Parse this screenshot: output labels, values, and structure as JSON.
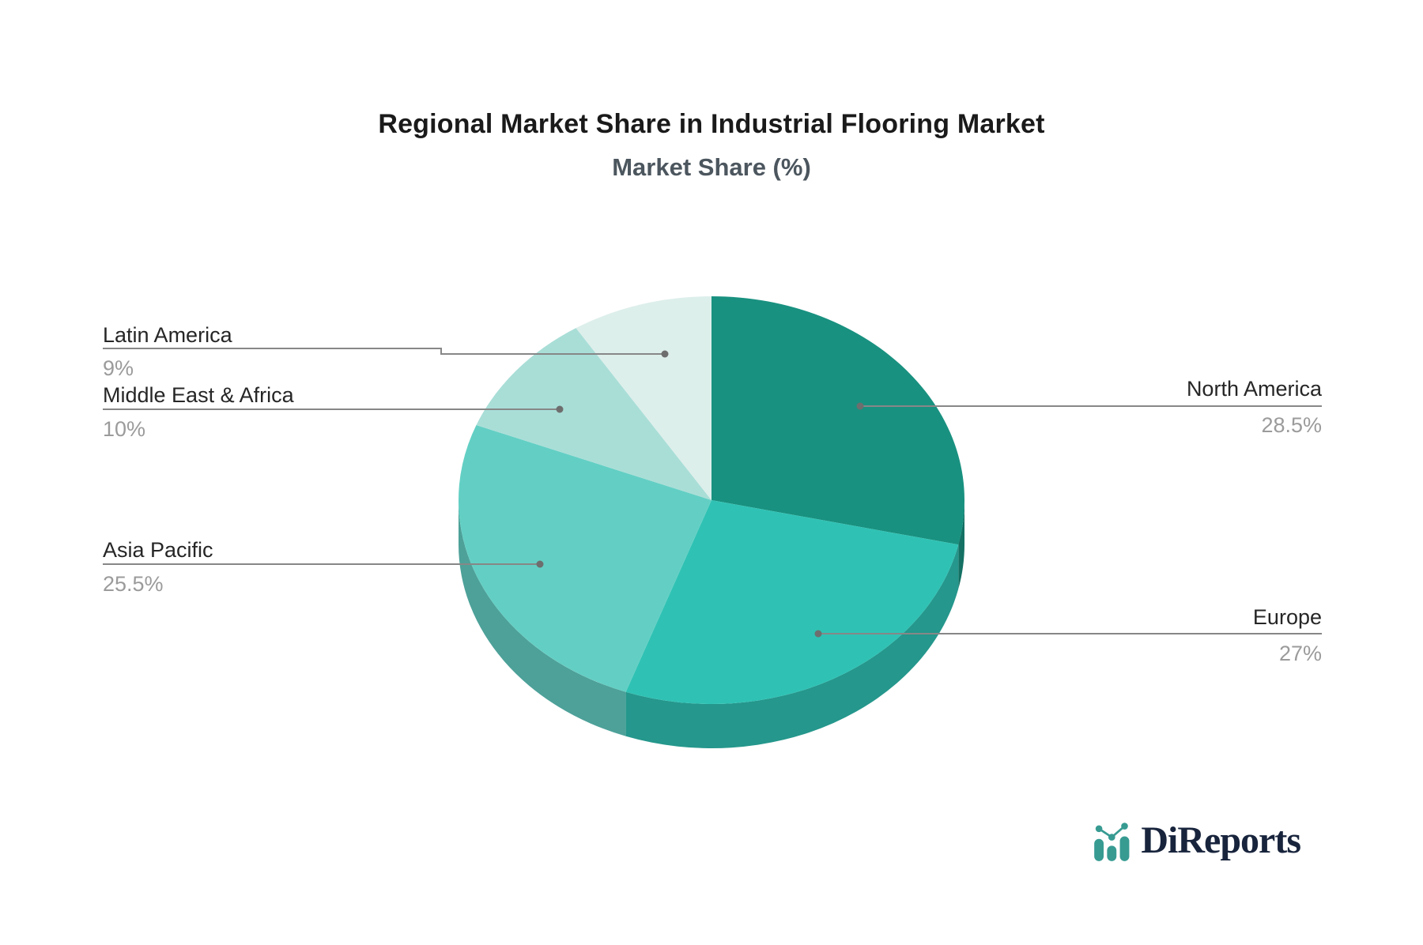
{
  "page": {
    "background": "#ffffff"
  },
  "chart_data": {
    "type": "pie",
    "title": "Regional Market Share in Industrial Flooring Market",
    "subtitle": "Market Share (%)",
    "effect": "3d",
    "direction": "clockwise",
    "start_angle_deg": 0,
    "legend_position": "none",
    "slices": [
      {
        "label": "North America",
        "value": 28.5,
        "display": "28.5%",
        "color": "#199180"
      },
      {
        "label": "Europe",
        "value": 27,
        "display": "27%",
        "color": "#2fc2b4"
      },
      {
        "label": "Asia Pacific",
        "value": 25.5,
        "display": "25.5%",
        "color": "#63cfc4"
      },
      {
        "label": "Middle East & Africa",
        "value": 10,
        "display": "10%",
        "color": "#a9ded7"
      },
      {
        "label": "Latin America",
        "value": 9,
        "display": "9%",
        "color": "#ddefeb"
      }
    ],
    "leader_line_color": "#878787",
    "leader_dot_color": "#6e6e6e",
    "label_text_color": "#262626",
    "pct_text_color": "#9b9b9b"
  },
  "branding": {
    "logo_text": "DiReports",
    "logo_text_color": "#18243c",
    "logo_icon": "bar-chart-icon",
    "logo_icon_color": "#379b92"
  }
}
